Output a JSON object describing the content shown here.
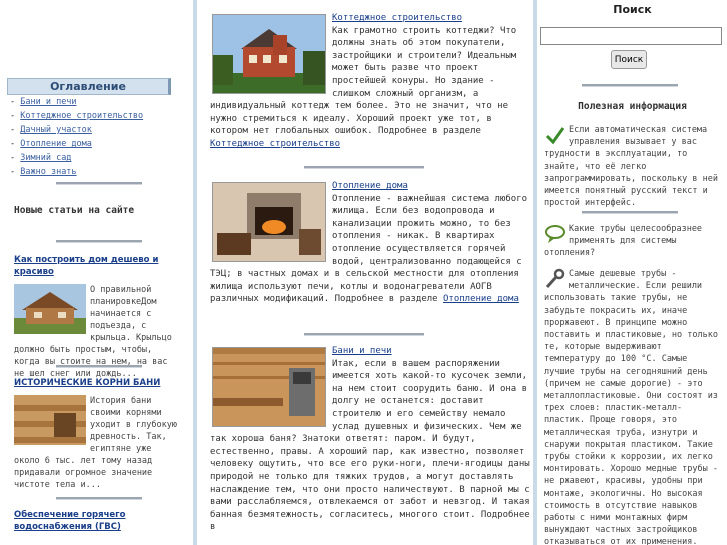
{
  "left": {
    "toc_title": "Оглавление",
    "toc_items": [
      {
        "label": "Бани и печи"
      },
      {
        "label": "Коттеджное строительство"
      },
      {
        "label": "Дачный участок"
      },
      {
        "label": "Отопление дома"
      },
      {
        "label": "Зимний сад"
      },
      {
        "label": "Важно знать"
      }
    ],
    "new_articles_title": "Новые статьи на сайте",
    "news": [
      {
        "title": "Как построить дом дешево и красиво",
        "text": "О правильной планировкеДом начинается с подъезда, с крыльца. Крыльцо должно быть простым, чтобы, когда вы стоите на нем, на вас не шел снег или дождь..."
      },
      {
        "title": "ИСТОРИЧЕСКИЕ КОРНИ БАНИ",
        "text": "История бани своими корнями уходит в глубокую древность. Так, египтяне уже около 6 тыс. лет тому назад придавали огромное значение чистоте тела и..."
      },
      {
        "title": "Обеспечение горячего водоснабжения (ГВС)"
      }
    ]
  },
  "main": {
    "articles": [
      {
        "title": "Коттеджное строительство",
        "text": "Как грамотно строить коттеджи? Что должны знать об этом покупатели, застройщики и строители? Идеальным может быть разве что проект простейшей конуры. Но здание - слишком сложный организм, а индивидуальный коттедж тем более. Это не значит, что не нужно стремиться к идеалу. Хороший проект уже тот, в котором нет глобальных ошибок. Подробнее в разделе",
        "link": "Коттеджное строительство"
      },
      {
        "title": "Отопление дома",
        "text": "Отопление - важнейшая система любого жилища. Если без водопровода и канализации прожить можно, то без отопления - никак. В квартирах отопление осуществляется горячей водой, централизованно подающейся с ТЭЦ; в частных домах и в сельской местности для отопления жилища используют печи, котлы и водонагреватели АОГВ различных модификаций. Подробнее в разделе",
        "link": "Отопление дома"
      },
      {
        "title": "Бани и печи",
        "text": "Итак, если в вашем распоряжении имеется хоть какой-то кусочек земли, на нем стоит соорудить баню. И она в долгу не останется: доставит строителю и его семейству немало услад душевных и физических. Чем же так хороша баня? Знатоки ответят: паром. И будут, естественно, правы. А хороший пар, как известно, позволяет человеку ощутить, что все его руки-ноги, плечи-ягодицы даны природой не только для тяжких трудов, а могут доставлять наслаждение тем, что они просто наличествуют. В парной мы с вами расслабляемся, отвлекаемся от забот и невзгод. И такая банная безмятежность, согласитесь, многого стоит. Подробнее в",
        "link": ""
      }
    ]
  },
  "right": {
    "search_title": "Поиск",
    "search_button": "Поиск",
    "search_value": "",
    "useful_title": "Полезная информация",
    "info": [
      {
        "icon": "check-icon",
        "text": "Если автоматическая система управления вызывает у вас трудности в эксплуатации, то знайте, что её легко запрограммировать, поскольку в ней имеется понятный русский текст и простой интерфейс."
      },
      {
        "icon": "speech-bubble-icon",
        "text": "Какие трубы целесообразнее применять для системы отопления?"
      },
      {
        "icon": "wrench-icon",
        "text": "Самые дешевые трубы - металлические. Если решили использовать такие трубы, не забудьте покрасить их, иначе проржавеют. В принципе можно поставить и пластиковые, но только те, которые выдерживают температуру до 100 °С. Самые лучшие трубы на сегодняшний день (причем не самые дорогие) - это металлопластиковые. Они состоят из трех слоев: пластик-металл-пластик. Проще говоря, это металлическая труба, изнутри и снаружи покрытая пластиком. Такие трубы стойки к коррозии, их легко монтировать. Хорошо медные трубы - не ржавеют, красивы, удобны при монтаже, экологичны. Но высокая стоимость в отсутствие навыков работы с ними монтажных фирм вынуждают частных застройщиков отказываться от их применения."
      }
    ]
  }
}
